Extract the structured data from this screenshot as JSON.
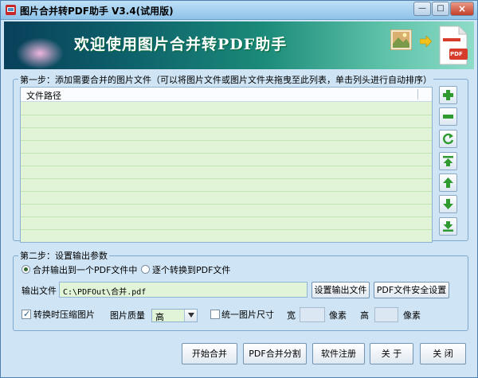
{
  "window": {
    "title": "图片合并转PDF助手 V3.4(试用版)",
    "controls": {
      "minimize": "—",
      "maximize": "□",
      "close": "×"
    }
  },
  "banner": {
    "welcome": "欢迎使用图片合并转PDF助手",
    "pdf_badge": "PDF"
  },
  "step1": {
    "legend": "第一步：添加需要合并的图片文件（可以将图片文件或图片文件夹拖曳至此列表，单击列头进行自动排序）",
    "column_header": "文件路径",
    "rows": [],
    "side_buttons": [
      {
        "name": "add-button",
        "icon": "plus-icon"
      },
      {
        "name": "remove-button",
        "icon": "minus-icon"
      },
      {
        "name": "clear-button",
        "icon": "refresh-icon"
      },
      {
        "name": "move-top-button",
        "icon": "arrow-top-icon"
      },
      {
        "name": "move-up-button",
        "icon": "arrow-up-icon"
      },
      {
        "name": "move-down-button",
        "icon": "arrow-down-icon"
      },
      {
        "name": "move-bottom-button",
        "icon": "arrow-bottom-icon"
      }
    ]
  },
  "step2": {
    "legend": "第二步：设置输出参数",
    "radio_merge": "合并输出到一个PDF文件中",
    "radio_separate": "逐个转换到PDF文件",
    "merge_selected": true,
    "output_label": "输出文件",
    "output_value": "C:\\PDFOut\\合并.pdf",
    "set_output_button": "设置输出文件",
    "security_button": "PDF文件安全设置",
    "compress_label": "转换时压缩图片",
    "compress_checked": true,
    "quality_label": "图片质量",
    "quality_value": "高",
    "unify_label": "统一图片尺寸",
    "unify_checked": false,
    "width_label": "宽",
    "width_unit": "像素",
    "height_label": "高",
    "height_unit": "像素"
  },
  "footer": {
    "start_button": "开始合并",
    "split_button": "PDF合并分割",
    "register_button": "软件注册",
    "about_button": "关 于",
    "close_button": "关 闭"
  },
  "colors": {
    "accent_green": "#2f9a2f",
    "list_bg": "#e1f4d7",
    "window_bg": "#cfe4f4"
  }
}
